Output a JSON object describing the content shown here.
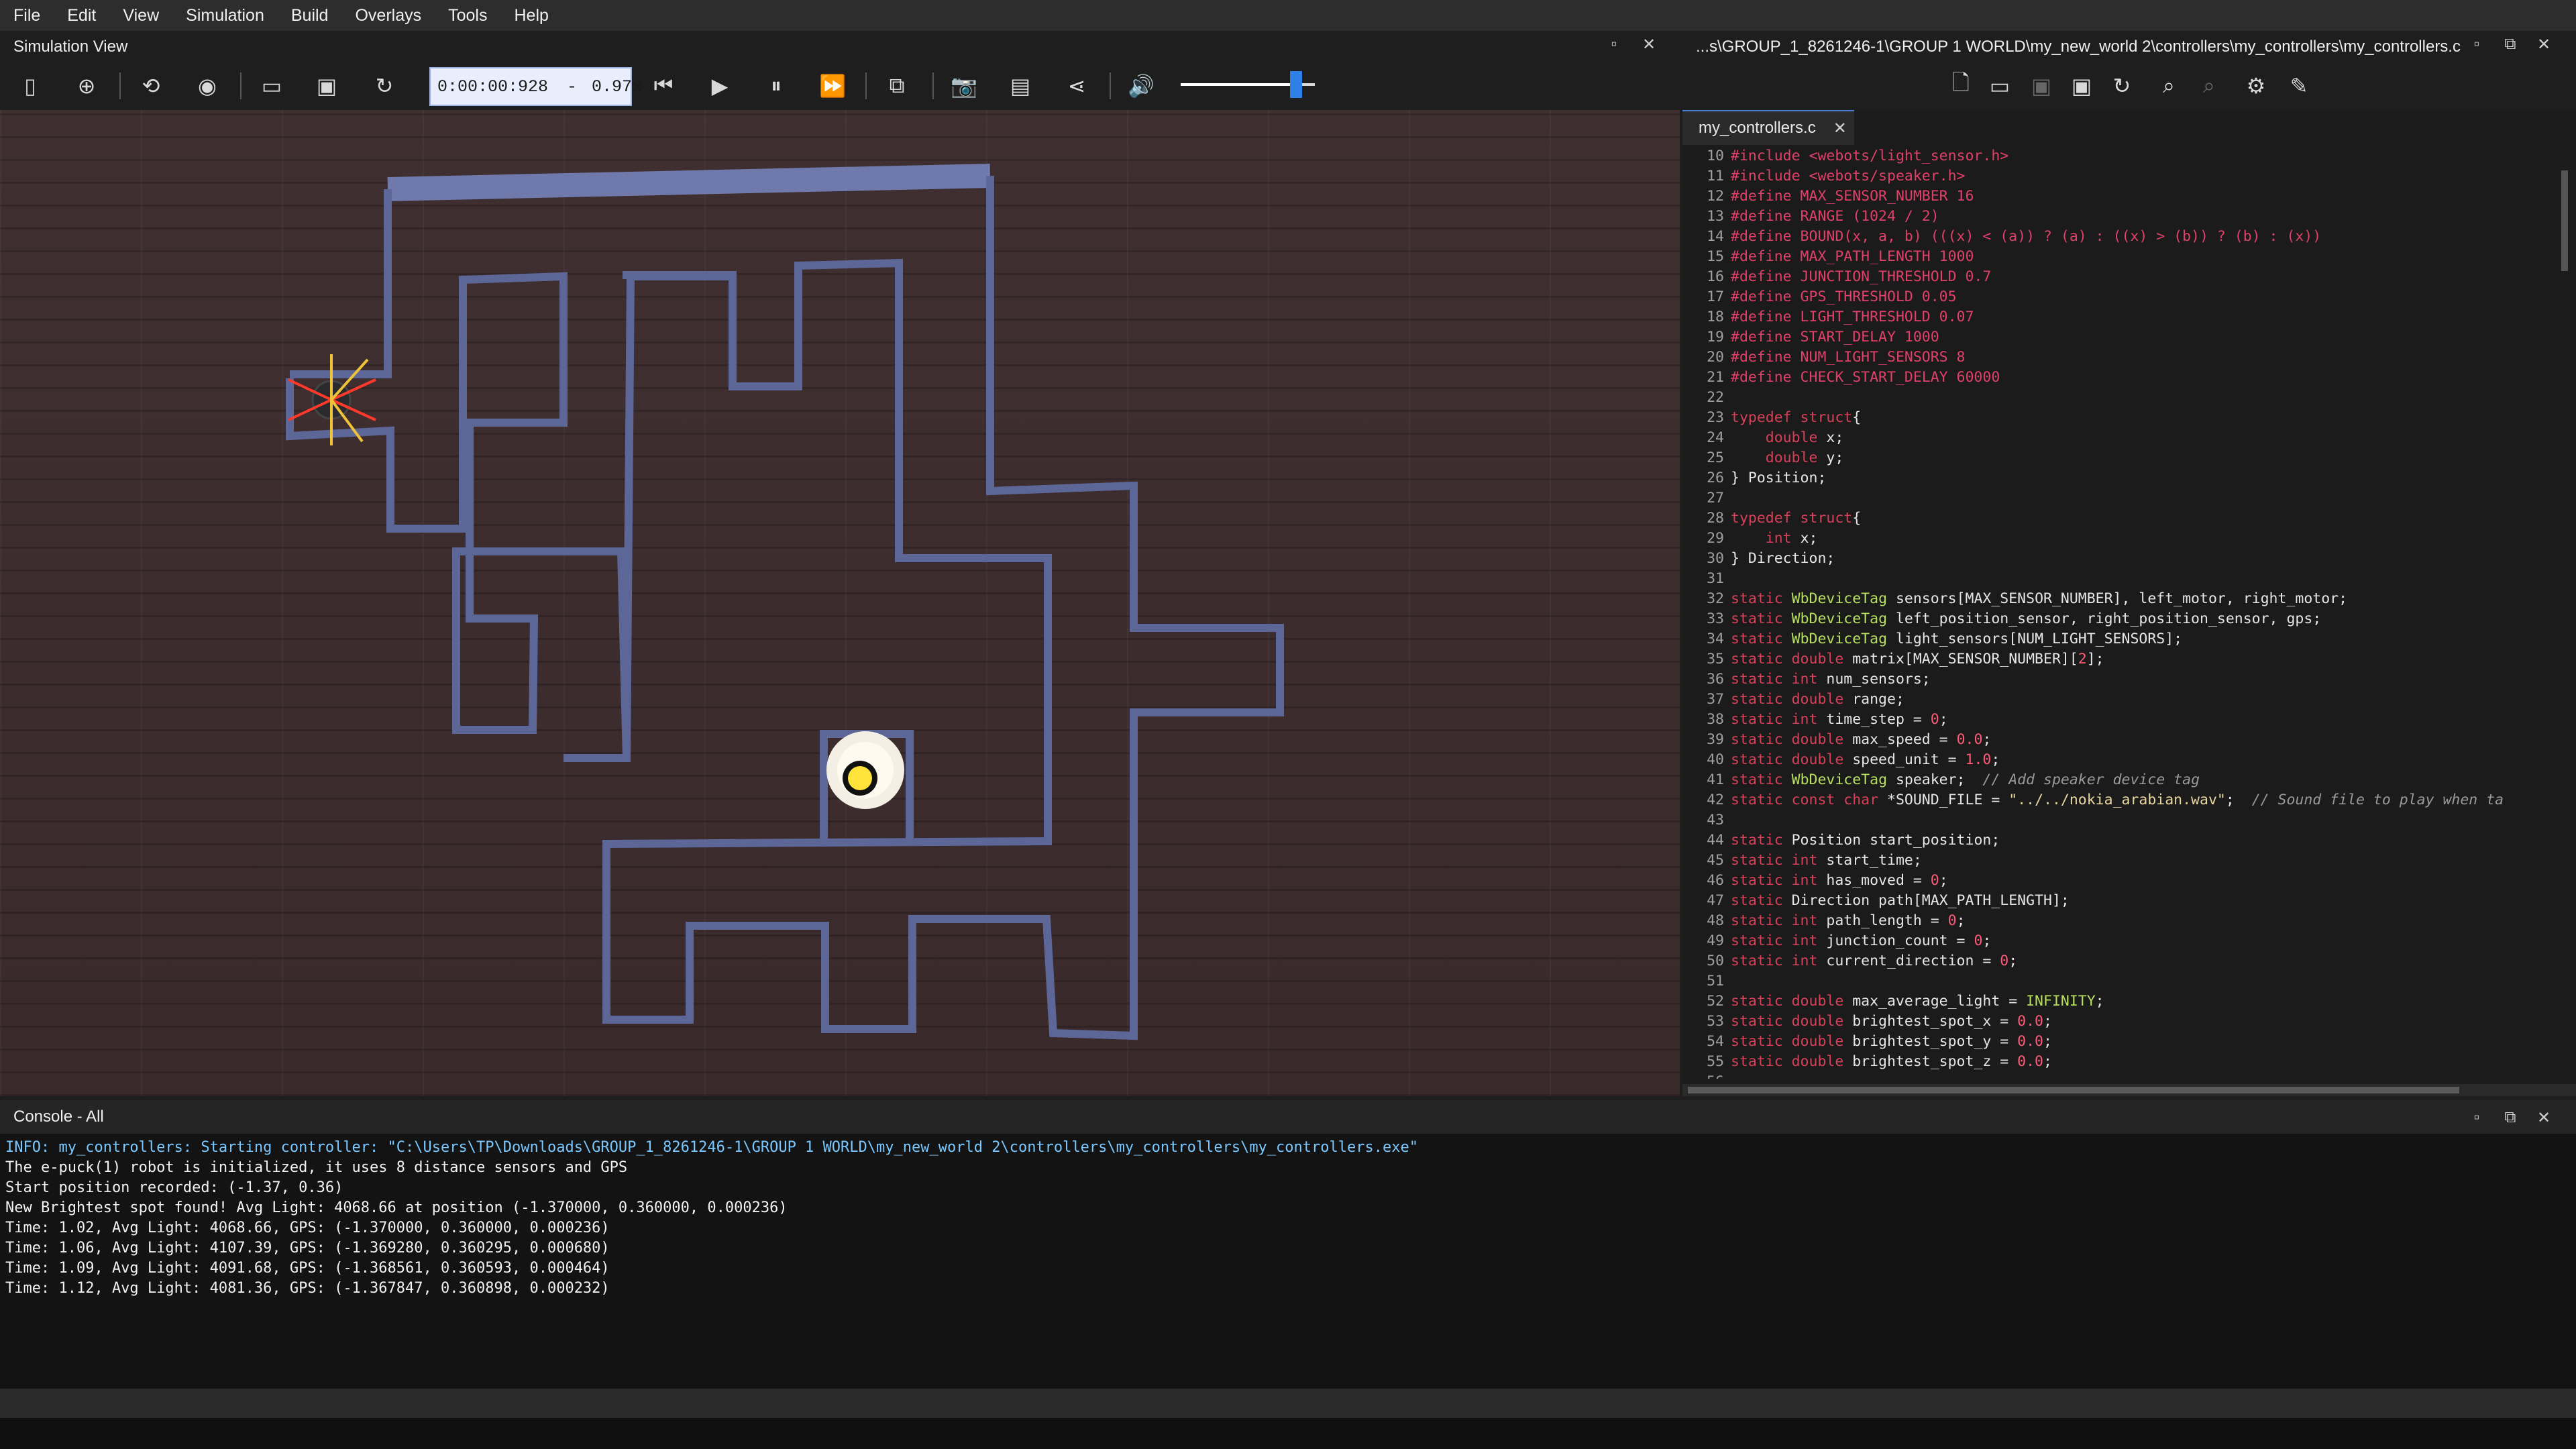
{
  "menu": [
    "File",
    "Edit",
    "View",
    "Simulation",
    "Build",
    "Overlays",
    "Tools",
    "Help"
  ],
  "sim_panel": {
    "title": "Simulation View"
  },
  "editor_panel": {
    "title": "...s\\GROUP_1_8261246-1\\GROUP 1 WORLD\\my_new_world 2\\controllers\\my_controllers\\my_controllers.c",
    "tab": "my_controllers.c"
  },
  "toolbar": {
    "time": "0:00:00:928",
    "speed_sep": "-",
    "speed": "0.97x",
    "volume_level": 0.86
  },
  "code_lines": [
    {
      "n": "10",
      "t": [
        [
          "pp",
          "#include <webots/light_sensor.h>"
        ]
      ]
    },
    {
      "n": "11",
      "t": [
        [
          "pp",
          "#include <webots/speaker.h>"
        ]
      ]
    },
    {
      "n": "12",
      "t": [
        [
          "pp",
          "#define MAX_SENSOR_NUMBER 16"
        ]
      ]
    },
    {
      "n": "13",
      "t": [
        [
          "pp",
          "#define RANGE (1024 / 2)"
        ]
      ]
    },
    {
      "n": "14",
      "t": [
        [
          "pp",
          "#define BOUND(x, a, b) (((x) < (a)) ? (a) : ((x) > (b)) ? (b) : (x))"
        ]
      ]
    },
    {
      "n": "15",
      "t": [
        [
          "pp",
          "#define MAX_PATH_LENGTH 1000"
        ]
      ]
    },
    {
      "n": "16",
      "t": [
        [
          "pp",
          "#define JUNCTION_THRESHOLD 0.7"
        ]
      ]
    },
    {
      "n": "17",
      "t": [
        [
          "pp",
          "#define GPS_THRESHOLD 0.05"
        ]
      ]
    },
    {
      "n": "18",
      "t": [
        [
          "pp",
          "#define LIGHT_THRESHOLD 0.07"
        ]
      ]
    },
    {
      "n": "19",
      "t": [
        [
          "pp",
          "#define START_DELAY 1000"
        ]
      ]
    },
    {
      "n": "20",
      "t": [
        [
          "pp",
          "#define NUM_LIGHT_SENSORS 8"
        ]
      ]
    },
    {
      "n": "21",
      "t": [
        [
          "pp",
          "#define CHECK_START_DELAY 60000"
        ]
      ]
    },
    {
      "n": "22",
      "t": []
    },
    {
      "n": "23",
      "t": [
        [
          "kw",
          "typedef struct"
        ],
        [
          "",
          "{"
        ]
      ]
    },
    {
      "n": "24",
      "t": [
        [
          "",
          "    "
        ],
        [
          "kw",
          "double"
        ],
        [
          "",
          " x;"
        ]
      ]
    },
    {
      "n": "25",
      "t": [
        [
          "",
          "    "
        ],
        [
          "kw",
          "double"
        ],
        [
          "",
          " y;"
        ]
      ]
    },
    {
      "n": "26",
      "t": [
        [
          "",
          "} Position;"
        ]
      ]
    },
    {
      "n": "27",
      "t": []
    },
    {
      "n": "28",
      "t": [
        [
          "kw",
          "typedef struct"
        ],
        [
          "",
          "{"
        ]
      ]
    },
    {
      "n": "29",
      "t": [
        [
          "",
          "    "
        ],
        [
          "kw",
          "int"
        ],
        [
          "",
          " x;"
        ]
      ]
    },
    {
      "n": "30",
      "t": [
        [
          "",
          "} Direction;"
        ]
      ]
    },
    {
      "n": "31",
      "t": []
    },
    {
      "n": "32",
      "t": [
        [
          "kw",
          "static"
        ],
        [
          "",
          " "
        ],
        [
          "ty",
          "WbDeviceTag"
        ],
        [
          "",
          " sensors[MAX_SENSOR_NUMBER], left_motor, right_motor;"
        ]
      ]
    },
    {
      "n": "33",
      "t": [
        [
          "kw",
          "static"
        ],
        [
          "",
          " "
        ],
        [
          "ty",
          "WbDeviceTag"
        ],
        [
          "",
          " left_position_sensor, right_position_sensor, gps;"
        ]
      ]
    },
    {
      "n": "34",
      "t": [
        [
          "kw",
          "static"
        ],
        [
          "",
          " "
        ],
        [
          "ty",
          "WbDeviceTag"
        ],
        [
          "",
          " light_sensors[NUM_LIGHT_SENSORS];"
        ]
      ]
    },
    {
      "n": "35",
      "t": [
        [
          "kw",
          "static double"
        ],
        [
          "",
          " matrix[MAX_SENSOR_NUMBER]["
        ],
        [
          "num",
          "2"
        ],
        [
          "",
          "];"
        ]
      ]
    },
    {
      "n": "36",
      "t": [
        [
          "kw",
          "static int"
        ],
        [
          "",
          " num_sensors;"
        ]
      ]
    },
    {
      "n": "37",
      "t": [
        [
          "kw",
          "static double"
        ],
        [
          "",
          " range;"
        ]
      ]
    },
    {
      "n": "38",
      "t": [
        [
          "kw",
          "static int"
        ],
        [
          "",
          " time_step = "
        ],
        [
          "num",
          "0"
        ],
        [
          "",
          ";"
        ]
      ]
    },
    {
      "n": "39",
      "t": [
        [
          "kw",
          "static double"
        ],
        [
          "",
          " max_speed = "
        ],
        [
          "num",
          "0.0"
        ],
        [
          "",
          ";"
        ]
      ]
    },
    {
      "n": "40",
      "t": [
        [
          "kw",
          "static double"
        ],
        [
          "",
          " speed_unit = "
        ],
        [
          "num",
          "1.0"
        ],
        [
          "",
          ";"
        ]
      ]
    },
    {
      "n": "41",
      "t": [
        [
          "kw",
          "static"
        ],
        [
          "",
          " "
        ],
        [
          "ty",
          "WbDeviceTag"
        ],
        [
          "",
          " speaker;  "
        ],
        [
          "cm",
          "// Add speaker device tag"
        ]
      ]
    },
    {
      "n": "42",
      "t": [
        [
          "kw",
          "static const char"
        ],
        [
          "",
          " *SOUND_FILE = "
        ],
        [
          "str",
          "\"../../nokia_arabian.wav\""
        ],
        [
          "",
          ";  "
        ],
        [
          "cm",
          "// Sound file to play when ta"
        ]
      ]
    },
    {
      "n": "43",
      "t": []
    },
    {
      "n": "44",
      "t": [
        [
          "kw",
          "static"
        ],
        [
          "",
          " Position start_position;"
        ]
      ]
    },
    {
      "n": "45",
      "t": [
        [
          "kw",
          "static int"
        ],
        [
          "",
          " start_time;"
        ]
      ]
    },
    {
      "n": "46",
      "t": [
        [
          "kw",
          "static int"
        ],
        [
          "",
          " has_moved = "
        ],
        [
          "num",
          "0"
        ],
        [
          "",
          ";"
        ]
      ]
    },
    {
      "n": "47",
      "t": [
        [
          "kw",
          "static"
        ],
        [
          "",
          " Direction path[MAX_PATH_LENGTH];"
        ]
      ]
    },
    {
      "n": "48",
      "t": [
        [
          "kw",
          "static int"
        ],
        [
          "",
          " path_length = "
        ],
        [
          "num",
          "0"
        ],
        [
          "",
          ";"
        ]
      ]
    },
    {
      "n": "49",
      "t": [
        [
          "kw",
          "static int"
        ],
        [
          "",
          " junction_count = "
        ],
        [
          "num",
          "0"
        ],
        [
          "",
          ";"
        ]
      ]
    },
    {
      "n": "50",
      "t": [
        [
          "kw",
          "static int"
        ],
        [
          "",
          " current_direction = "
        ],
        [
          "num",
          "0"
        ],
        [
          "",
          ";"
        ]
      ]
    },
    {
      "n": "51",
      "t": []
    },
    {
      "n": "52",
      "t": [
        [
          "kw",
          "static double"
        ],
        [
          "",
          " max_average_light = "
        ],
        [
          "ty",
          "INFINITY"
        ],
        [
          "",
          ";"
        ]
      ]
    },
    {
      "n": "53",
      "t": [
        [
          "kw",
          "static double"
        ],
        [
          "",
          " brightest_spot_x = "
        ],
        [
          "num",
          "0.0"
        ],
        [
          "",
          ";"
        ]
      ]
    },
    {
      "n": "54",
      "t": [
        [
          "kw",
          "static double"
        ],
        [
          "",
          " brightest_spot_y = "
        ],
        [
          "num",
          "0.0"
        ],
        [
          "",
          ";"
        ]
      ]
    },
    {
      "n": "55",
      "t": [
        [
          "kw",
          "static double"
        ],
        [
          "",
          " brightest_spot_z = "
        ],
        [
          "num",
          "0.0"
        ],
        [
          "",
          ";"
        ]
      ]
    },
    {
      "n": "56",
      "t": []
    }
  ],
  "console": {
    "title": "Console - All",
    "lines": [
      {
        "cls": "con-info",
        "text": "INFO: my_controllers: Starting controller: \"C:\\Users\\TP\\Downloads\\GROUP_1_8261246-1\\GROUP 1 WORLD\\my_new_world 2\\controllers\\my_controllers\\my_controllers.exe\""
      },
      {
        "cls": "",
        "text": "The e-puck(1) robot is initialized, it uses 8 distance sensors and GPS"
      },
      {
        "cls": "",
        "text": "Start position recorded: (-1.37, 0.36)"
      },
      {
        "cls": "",
        "text": "New Brightest spot found! Avg Light: 4068.66 at position (-1.370000, 0.360000, 0.000236)"
      },
      {
        "cls": "",
        "text": "Time: 1.02, Avg Light: 4068.66, GPS: (-1.370000, 0.360000, 0.000236)"
      },
      {
        "cls": "",
        "text": "Time: 1.06, Avg Light: 4107.39, GPS: (-1.369280, 0.360295, 0.000680)"
      },
      {
        "cls": "",
        "text": "Time: 1.09, Avg Light: 4091.68, GPS: (-1.368561, 0.360593, 0.000464)"
      },
      {
        "cls": "",
        "text": "Time: 1.12, Avg Light: 4081.36, GPS: (-1.367847, 0.360898, 0.000232)"
      }
    ]
  },
  "icons": {
    "toolbar": [
      "toggle-scene-tree-icon",
      "add-node-icon",
      "reload-world-icon",
      "view-icon",
      "open-world-icon",
      "save-world-icon",
      "reset-simulation-icon",
      "step-back-icon",
      "play-icon",
      "pause-icon",
      "fast-forward-icon",
      "rendering-toggle-icon",
      "screenshot-icon",
      "record-movie-icon",
      "share-icon",
      "volume-icon"
    ],
    "editor_toolbar": [
      "new-file-icon",
      "open-file-icon",
      "save-file-icon",
      "save-as-icon",
      "revert-icon",
      "find-icon",
      "replace-icon",
      "build-settings-icon",
      "clean-build-icon"
    ]
  },
  "colors": {
    "accent": "#2f7fe8",
    "wall": "#5f6a9a",
    "wall_top": "#6e78aa"
  }
}
